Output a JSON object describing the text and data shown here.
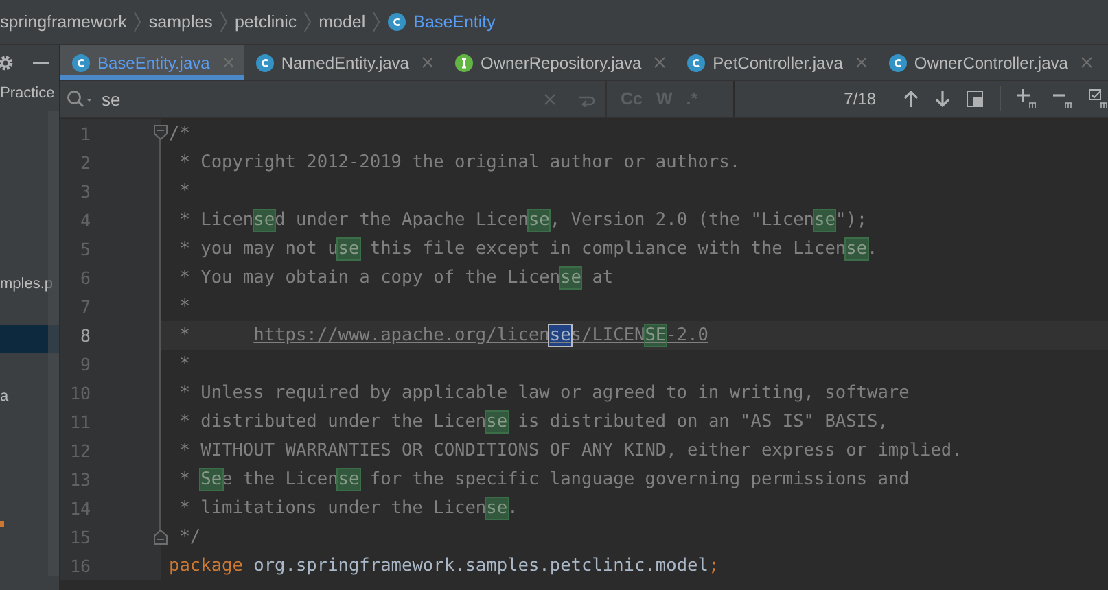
{
  "breadcrumbs": {
    "items": [
      {
        "label": "springframework",
        "kind": "folder"
      },
      {
        "label": "samples",
        "kind": "folder"
      },
      {
        "label": "petclinic",
        "kind": "folder"
      },
      {
        "label": "model",
        "kind": "folder"
      },
      {
        "label": "BaseEntity",
        "kind": "class"
      }
    ]
  },
  "tabs": [
    {
      "label": "BaseEntity.java",
      "kind": "class",
      "selected": true
    },
    {
      "label": "NamedEntity.java",
      "kind": "class",
      "selected": false
    },
    {
      "label": "OwnerRepository.java",
      "kind": "interface",
      "selected": false
    },
    {
      "label": "PetController.java",
      "kind": "class",
      "selected": false
    },
    {
      "label": "OwnerController.java",
      "kind": "class",
      "selected": false
    }
  ],
  "project_panel": {
    "items": [
      {
        "label": "Practice",
        "selected": false
      },
      {
        "label": "mples.p",
        "selected": false
      },
      {
        "selected": true
      },
      {
        "label": "a",
        "selected": false
      }
    ]
  },
  "search": {
    "value": "se",
    "options": [
      {
        "label": "Cc",
        "on": false
      },
      {
        "label": "W",
        "on": false
      },
      {
        "label": ".*",
        "on": false
      }
    ],
    "count": "7/18"
  },
  "editor": {
    "lines": [
      {
        "number": "1",
        "current": false,
        "fold_start": true,
        "fold_end": false,
        "segments": [
          {
            "text": "/*",
            "kind": "comment"
          }
        ]
      },
      {
        "number": "2",
        "current": false,
        "fold_start": false,
        "fold_end": false,
        "segments": [
          {
            "text": " * Copyright 2012-2019 the original author or authors.",
            "kind": "comment"
          }
        ]
      },
      {
        "number": "3",
        "current": false,
        "fold_start": false,
        "fold_end": false,
        "segments": [
          {
            "text": " *",
            "kind": "comment"
          }
        ]
      },
      {
        "number": "4",
        "current": false,
        "fold_start": false,
        "fold_end": false,
        "segments": [
          {
            "text": " * Licen",
            "kind": "comment"
          },
          {
            "text": "se",
            "kind": "match"
          },
          {
            "text": "d under the Apache Licen",
            "kind": "comment"
          },
          {
            "text": "se",
            "kind": "match"
          },
          {
            "text": ", Version 2.0 (the \"Licen",
            "kind": "comment"
          },
          {
            "text": "se",
            "kind": "match"
          },
          {
            "text": "\");",
            "kind": "comment"
          }
        ]
      },
      {
        "number": "5",
        "current": false,
        "fold_start": false,
        "fold_end": false,
        "segments": [
          {
            "text": " * you may not u",
            "kind": "comment"
          },
          {
            "text": "se",
            "kind": "match"
          },
          {
            "text": " this file except in compliance with the Licen",
            "kind": "comment"
          },
          {
            "text": "se",
            "kind": "match"
          },
          {
            "text": ".",
            "kind": "comment"
          }
        ]
      },
      {
        "number": "6",
        "current": false,
        "fold_start": false,
        "fold_end": false,
        "segments": [
          {
            "text": " * You may obtain a copy of the Licen",
            "kind": "comment"
          },
          {
            "text": "se",
            "kind": "match"
          },
          {
            "text": " at",
            "kind": "comment"
          }
        ]
      },
      {
        "number": "7",
        "current": false,
        "fold_start": false,
        "fold_end": false,
        "segments": [
          {
            "text": " *",
            "kind": "comment"
          }
        ]
      },
      {
        "number": "8",
        "current": true,
        "fold_start": false,
        "fold_end": false,
        "segments": [
          {
            "text": " *      ",
            "kind": "comment"
          },
          {
            "text": "https://www.apache.org/licen",
            "kind": "link"
          },
          {
            "text": "se",
            "kind": "link-current"
          },
          {
            "text": "s/LICEN",
            "kind": "link"
          },
          {
            "text": "SE",
            "kind": "link-match"
          },
          {
            "text": "-2.0",
            "kind": "link"
          }
        ]
      },
      {
        "number": "9",
        "current": false,
        "fold_start": false,
        "fold_end": false,
        "segments": [
          {
            "text": " *",
            "kind": "comment"
          }
        ]
      },
      {
        "number": "10",
        "current": false,
        "fold_start": false,
        "fold_end": false,
        "segments": [
          {
            "text": " * Unless required by applicable law or agreed to in writing, software",
            "kind": "comment"
          }
        ]
      },
      {
        "number": "11",
        "current": false,
        "fold_start": false,
        "fold_end": false,
        "segments": [
          {
            "text": " * distributed under the Licen",
            "kind": "comment"
          },
          {
            "text": "se",
            "kind": "match"
          },
          {
            "text": " is distributed on an \"AS IS\" BASIS,",
            "kind": "comment"
          }
        ]
      },
      {
        "number": "12",
        "current": false,
        "fold_start": false,
        "fold_end": false,
        "segments": [
          {
            "text": " * WITHOUT WARRANTIES OR CONDITIONS OF ANY KIND, either express or implied.",
            "kind": "comment"
          }
        ]
      },
      {
        "number": "13",
        "current": false,
        "fold_start": false,
        "fold_end": false,
        "segments": [
          {
            "text": " * ",
            "kind": "comment"
          },
          {
            "text": "Se",
            "kind": "match"
          },
          {
            "text": "e the Licen",
            "kind": "comment"
          },
          {
            "text": "se",
            "kind": "match"
          },
          {
            "text": " for the specific language governing permissions and",
            "kind": "comment"
          }
        ]
      },
      {
        "number": "14",
        "current": false,
        "fold_start": false,
        "fold_end": false,
        "segments": [
          {
            "text": " * limitations under the Licen",
            "kind": "comment"
          },
          {
            "text": "se",
            "kind": "match"
          },
          {
            "text": ".",
            "kind": "comment"
          }
        ]
      },
      {
        "number": "15",
        "current": false,
        "fold_start": false,
        "fold_end": true,
        "segments": [
          {
            "text": " */",
            "kind": "comment"
          }
        ]
      },
      {
        "number": "16",
        "current": false,
        "fold_start": false,
        "fold_end": false,
        "segments": [
          {
            "text": "package",
            "kind": "keyword"
          },
          {
            "text": " org.springframework.samples.petclinic.model",
            "kind": "plain"
          },
          {
            "text": ";",
            "kind": "keyword"
          }
        ]
      }
    ]
  }
}
